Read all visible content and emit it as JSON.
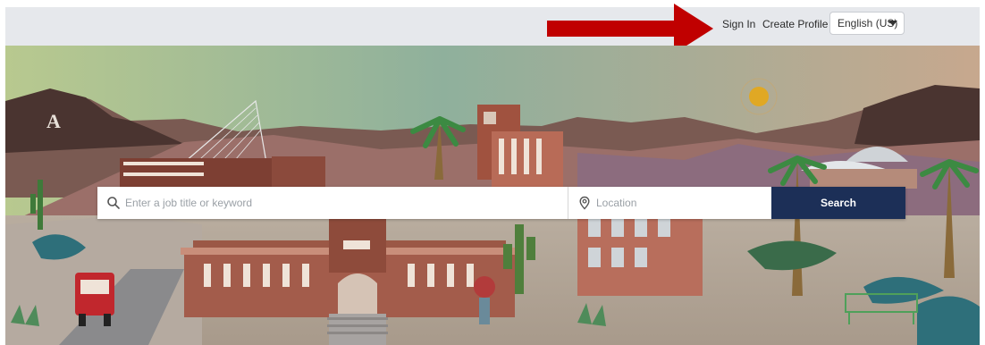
{
  "header": {
    "sign_in_label": "Sign In",
    "create_profile_label": "Create Profile",
    "language_selected": "English (US)"
  },
  "search": {
    "keyword_placeholder": "Enter a job title or keyword",
    "keyword_value": "",
    "location_placeholder": "Location",
    "location_value": "",
    "button_label": "Search"
  },
  "hero": {
    "mountain_letter": "A"
  },
  "icons": {
    "annotation_arrow": "arrow-right-icon",
    "keyword": "search-icon",
    "location": "map-pin-icon",
    "language": "chevron-down-icon"
  },
  "colors": {
    "topbar_bg": "#e6e8ec",
    "search_button_bg": "#1c2f57",
    "annotation_arrow": "#c00000"
  }
}
